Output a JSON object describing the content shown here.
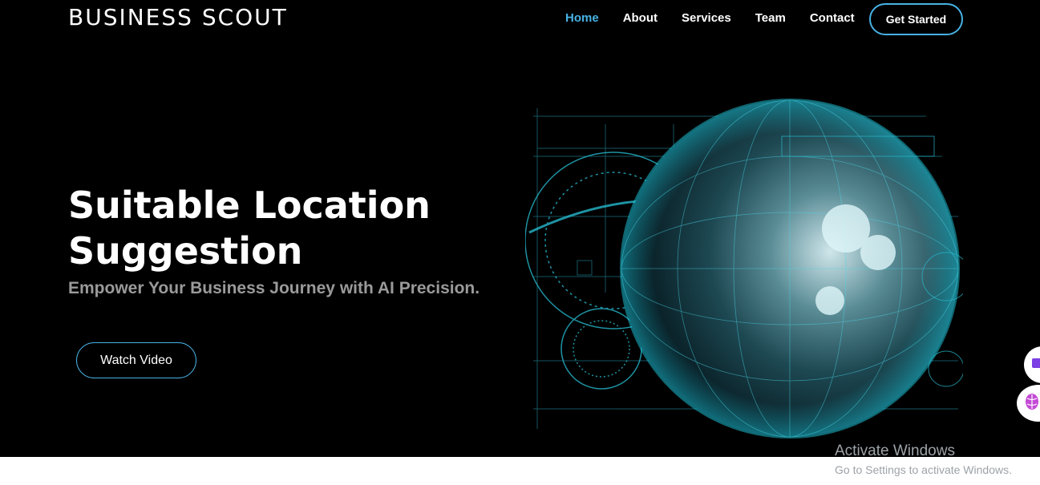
{
  "header": {
    "brand": "BUSINESS SCOUT",
    "nav": [
      "Home",
      "About",
      "Services",
      "Team",
      "Contact"
    ],
    "active_nav": "Home",
    "cta_label": "Get Started"
  },
  "hero": {
    "title": "Suitable Location Suggestion",
    "subtitle": "Empower Your Business Journey with AI Precision.",
    "watch_label": "Watch Video",
    "image_icon": "digital-globe-illustration"
  },
  "overlay": {
    "activate_title": "Activate Windows",
    "activate_subtitle": "Go to Settings to activate Windows."
  },
  "floaters": [
    {
      "icon": "chat-bubble-icon"
    },
    {
      "icon": "brain-icon"
    }
  ],
  "colors": {
    "accent": "#47b2e4",
    "background": "#000000",
    "subtitle": "#9a9a9a"
  }
}
